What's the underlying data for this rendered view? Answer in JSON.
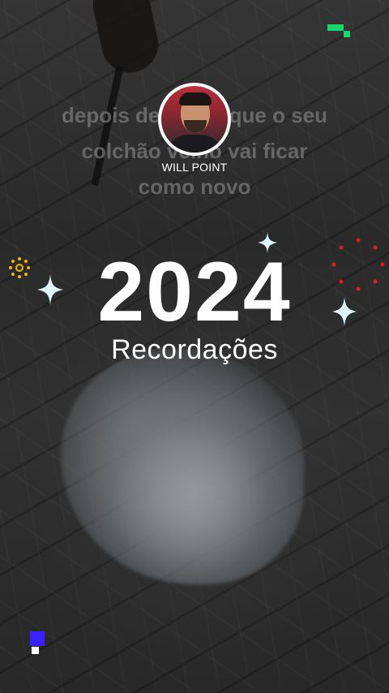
{
  "caption": {
    "lines": [
      "depois desse truque o seu",
      "colchão velho vai ficar",
      "como novo"
    ]
  },
  "profile": {
    "username": "WILL POINT"
  },
  "overlay": {
    "year": "2024",
    "subtitle": "Recordações"
  },
  "decorations": {
    "accent_green": "#19d36e",
    "accent_blue": "#3a1fff",
    "sparkle_color": "#dff6ff",
    "dot_ring_yellow": "#f2b705",
    "dot_ring_red": "#e01b24",
    "icons": [
      "sparkle-icon",
      "sun-dots-icon",
      "red-dot-ring-icon",
      "pixel-squares-icon"
    ]
  }
}
